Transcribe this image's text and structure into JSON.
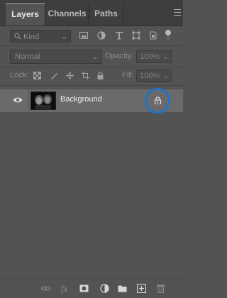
{
  "tabs": [
    {
      "label": "Layers",
      "active": true
    },
    {
      "label": "Channels",
      "active": false
    },
    {
      "label": "Paths",
      "active": false
    }
  ],
  "filter": {
    "kind_label": "Kind",
    "icons": [
      "pixel-filter-icon",
      "adjustment-filter-icon",
      "type-filter-icon",
      "shape-filter-icon",
      "smart-object-filter-icon",
      "filter-toggle-icon"
    ]
  },
  "blend": {
    "mode": "Normal",
    "opacity_label": "Opacity:",
    "opacity_value": "100%"
  },
  "lock": {
    "label": "Lock:",
    "fill_label": "Fill:",
    "fill_value": "100%",
    "icons": [
      "lock-transparent-icon",
      "lock-image-icon",
      "lock-position-icon",
      "lock-artboard-icon",
      "lock-all-icon"
    ]
  },
  "layers": [
    {
      "name": "Background",
      "visible": true,
      "locked": true
    }
  ],
  "highlight_color": "#1f74c7",
  "footer": {
    "icons": [
      "link-layers-icon",
      "fx-icon",
      "add-mask-icon",
      "adjustment-layer-icon",
      "group-folder-icon",
      "new-layer-icon",
      "trash-icon"
    ],
    "fx_text": "fx"
  }
}
